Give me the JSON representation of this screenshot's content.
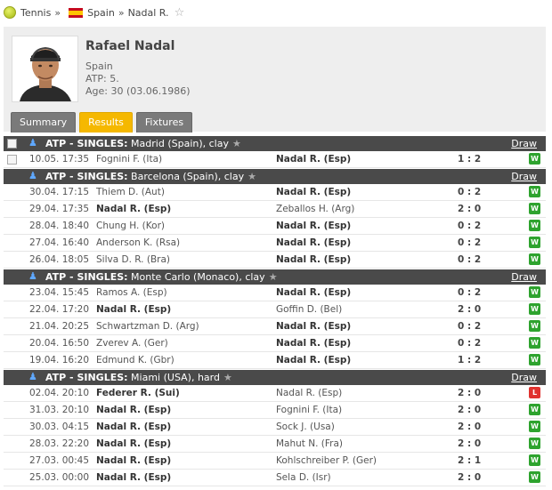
{
  "breadcrumb": {
    "sport": "Tennis",
    "country": "Spain",
    "player": "Nadal R."
  },
  "player": {
    "name": "Rafael Nadal",
    "country": "Spain",
    "ranking": "ATP: 5.",
    "age": "Age: 30 (03.06.1986)"
  },
  "tabs": [
    {
      "label": "Summary",
      "active": false
    },
    {
      "label": "Results",
      "active": true
    },
    {
      "label": "Fixtures",
      "active": false
    }
  ],
  "colors": {
    "win": "#2ea32e",
    "loss": "#e0322f",
    "active_tab": "#f5b800",
    "header_bar": "#4a4a4a"
  },
  "tournaments": [
    {
      "category": "ATP - SINGLES:",
      "name": "Madrid (Spain), clay",
      "draw_label": "Draw",
      "has_checkbox": true,
      "matches": [
        {
          "time": "10.05. 17:35",
          "home": "Fognini F. (Ita)",
          "away": "Nadal R. (Esp)",
          "score": "1 : 2",
          "result": "W",
          "bold": "away",
          "checkbox": true
        }
      ]
    },
    {
      "category": "ATP - SINGLES:",
      "name": "Barcelona (Spain), clay",
      "draw_label": "Draw",
      "matches": [
        {
          "time": "30.04. 17:15",
          "home": "Thiem D. (Aut)",
          "away": "Nadal R. (Esp)",
          "score": "0 : 2",
          "result": "W",
          "bold": "away"
        },
        {
          "time": "29.04. 17:35",
          "home": "Nadal R. (Esp)",
          "away": "Zeballos H. (Arg)",
          "score": "2 : 0",
          "result": "W",
          "bold": "home"
        },
        {
          "time": "28.04. 18:40",
          "home": "Chung H. (Kor)",
          "away": "Nadal R. (Esp)",
          "score": "0 : 2",
          "result": "W",
          "bold": "away"
        },
        {
          "time": "27.04. 16:40",
          "home": "Anderson K. (Rsa)",
          "away": "Nadal R. (Esp)",
          "score": "0 : 2",
          "result": "W",
          "bold": "away"
        },
        {
          "time": "26.04. 18:05",
          "home": "Silva D. R. (Bra)",
          "away": "Nadal R. (Esp)",
          "score": "0 : 2",
          "result": "W",
          "bold": "away"
        }
      ]
    },
    {
      "category": "ATP - SINGLES:",
      "name": "Monte Carlo (Monaco), clay",
      "draw_label": "Draw",
      "matches": [
        {
          "time": "23.04. 15:45",
          "home": "Ramos A. (Esp)",
          "away": "Nadal R. (Esp)",
          "score": "0 : 2",
          "result": "W",
          "bold": "away"
        },
        {
          "time": "22.04. 17:20",
          "home": "Nadal R. (Esp)",
          "away": "Goffin D. (Bel)",
          "score": "2 : 0",
          "result": "W",
          "bold": "home"
        },
        {
          "time": "21.04. 20:25",
          "home": "Schwartzman D. (Arg)",
          "away": "Nadal R. (Esp)",
          "score": "0 : 2",
          "result": "W",
          "bold": "away"
        },
        {
          "time": "20.04. 16:50",
          "home": "Zverev A. (Ger)",
          "away": "Nadal R. (Esp)",
          "score": "0 : 2",
          "result": "W",
          "bold": "away"
        },
        {
          "time": "19.04. 16:20",
          "home": "Edmund K. (Gbr)",
          "away": "Nadal R. (Esp)",
          "score": "1 : 2",
          "result": "W",
          "bold": "away"
        }
      ]
    },
    {
      "category": "ATP - SINGLES:",
      "name": "Miami (USA), hard",
      "draw_label": "Draw",
      "matches": [
        {
          "time": "02.04. 20:10",
          "home": "Federer R. (Sui)",
          "away": "Nadal R. (Esp)",
          "score": "2 : 0",
          "result": "L",
          "bold": "home"
        },
        {
          "time": "31.03. 20:10",
          "home": "Nadal R. (Esp)",
          "away": "Fognini F. (Ita)",
          "score": "2 : 0",
          "result": "W",
          "bold": "home"
        },
        {
          "time": "30.03. 04:15",
          "home": "Nadal R. (Esp)",
          "away": "Sock J. (Usa)",
          "score": "2 : 0",
          "result": "W",
          "bold": "home"
        },
        {
          "time": "28.03. 22:20",
          "home": "Nadal R. (Esp)",
          "away": "Mahut N. (Fra)",
          "score": "2 : 0",
          "result": "W",
          "bold": "home"
        },
        {
          "time": "27.03. 00:45",
          "home": "Nadal R. (Esp)",
          "away": "Kohlschreiber P. (Ger)",
          "score": "2 : 1",
          "result": "W",
          "bold": "home"
        },
        {
          "time": "25.03. 00:00",
          "home": "Nadal R. (Esp)",
          "away": "Sela D. (Isr)",
          "score": "2 : 0",
          "result": "W",
          "bold": "home"
        }
      ]
    }
  ]
}
